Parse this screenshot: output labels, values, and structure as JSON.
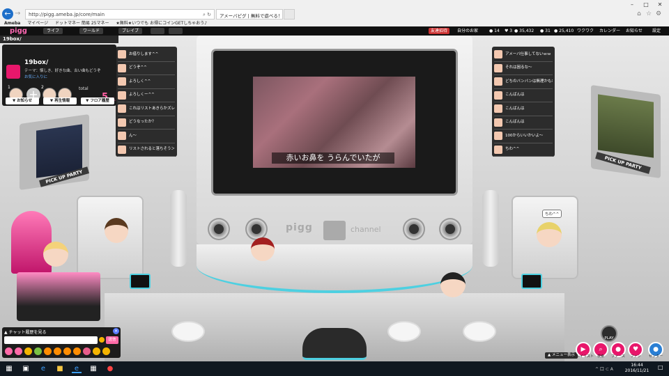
{
  "browser": {
    "url": "http://pigg.ameba.jp/core/main",
    "tab_title": "アメーバピグ | 無料で遊べる！...",
    "favorites": [
      "Ameba",
      "マイページ",
      "ドットマネー 簡易 25マネー",
      "★無料★いつでも お得にコインGETしちゃおう♪"
    ],
    "back_icon": "back-arrow-icon",
    "forward_icon": "forward-arrow-icon"
  },
  "topbar": {
    "logo": "pigg",
    "nav": [
      "ライフ",
      "ワールド",
      "ブレイブ"
    ],
    "status_badge": "友達招待",
    "my_room": "自分のお家",
    "stats": [
      "14",
      "3",
      "35,432",
      "31",
      "25,410"
    ],
    "waku": "ワクワク",
    "calendar": "カレンダー",
    "notice": "お知らせ",
    "settings": "設定"
  },
  "room": {
    "header": "19box/",
    "name": "19box/",
    "theme": "テーマ：懐しき、好きな曲、古い曲もどうぞ",
    "fav": "お気に入りに",
    "total_label": "total",
    "total_count": "5",
    "total_unit": "人",
    "seat_nums": [
      "1",
      "2"
    ],
    "buttons": [
      "▼ お知らせ",
      "▼ 再生情報",
      "▼ フロア履歴"
    ]
  },
  "stage": {
    "subtitle": "赤いお鼻を うらんでいたが",
    "logo": "pigg",
    "channel": "channel",
    "pick_left": "PICK UP PARTY",
    "pick_right": "PICK UP PARTY",
    "play": "PLAY"
  },
  "chat_left": [
    "お借りします^^",
    "どうぞ^^",
    "よろしく^^",
    "よろしくー^^",
    "これはリストあきらかズレね",
    "どうなったか？",
    "ん～",
    "リストされると落ちそう＞＜"
  ],
  "chat_right": [
    "アメーバ仕事してないｗｗ",
    "それは困るな～",
    "どちのバンバンは無理かもね",
    "こんばんは",
    "こんばんは",
    "こんばんは",
    "100からいいかいよ～",
    "ちわ^^"
  ],
  "speech_bubble": "ちわ^^",
  "chat_input": {
    "header": "チャット履歴を見る",
    "send": "送信"
  },
  "bottom_right": {
    "menu": "▲ メニュー表示",
    "buttons": [
      "プレイリスト",
      "検索",
      "ファース",
      "ファン",
      "センター"
    ]
  },
  "taskbar": {
    "time": "16:44",
    "date": "2016/11/21",
    "tray": "^ 口 ⊂ A"
  },
  "colors": {
    "accent": "#e8176b",
    "cyan": "#4dd0e1",
    "dark": "#1c1c1c"
  }
}
